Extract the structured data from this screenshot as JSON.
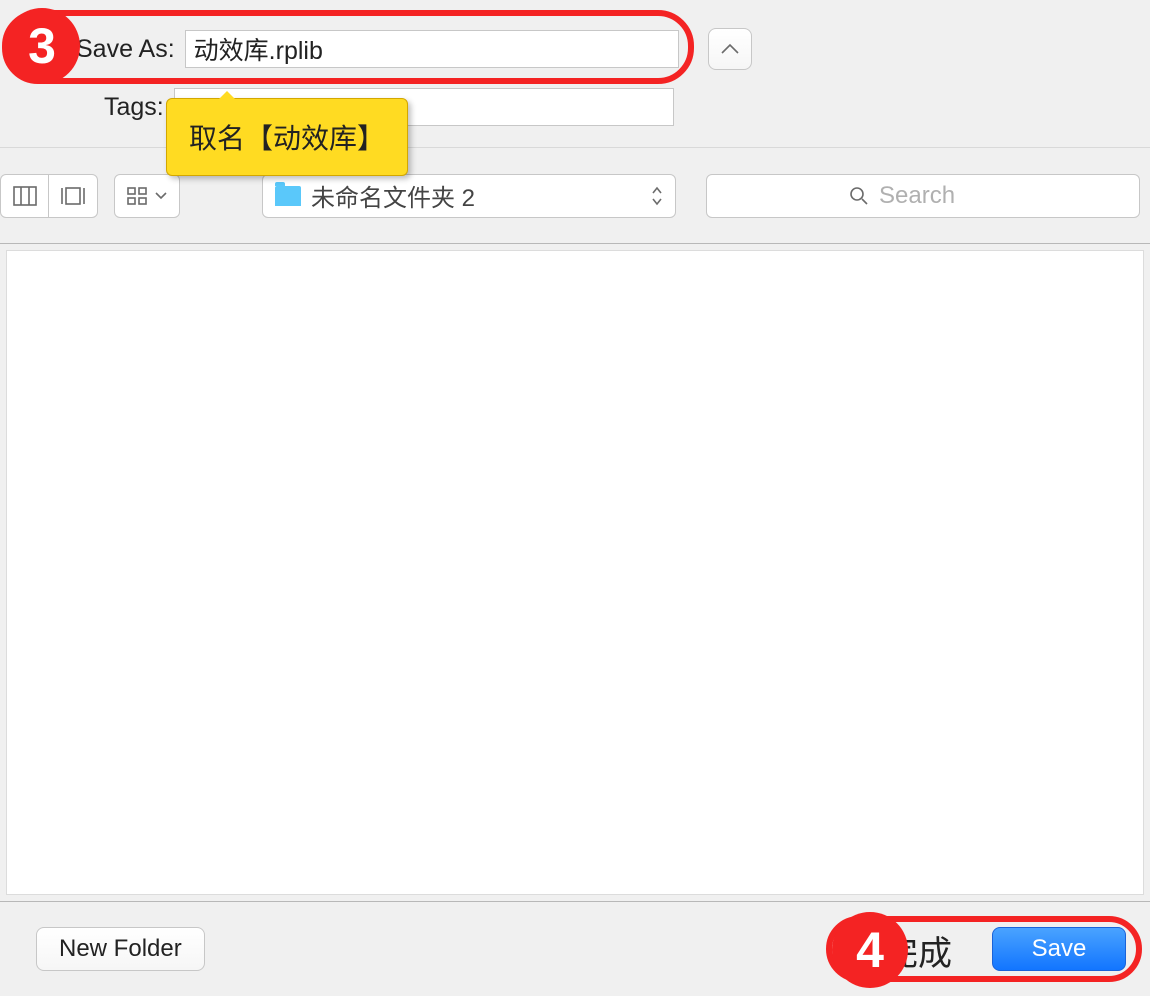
{
  "labels": {
    "save_as": "Save As:",
    "tags": "Tags:"
  },
  "inputs": {
    "save_as_value": "动效库.rplib",
    "tags_value": ""
  },
  "toolbar": {
    "path_label": "未命名文件夹 2",
    "search_placeholder": "Search"
  },
  "buttons": {
    "new_folder": "New Folder",
    "save": "Save"
  },
  "annotations": {
    "step3_num": "3",
    "step3_tip": "取名【动效库】",
    "step4_num": "4",
    "step4_text": "完成"
  }
}
